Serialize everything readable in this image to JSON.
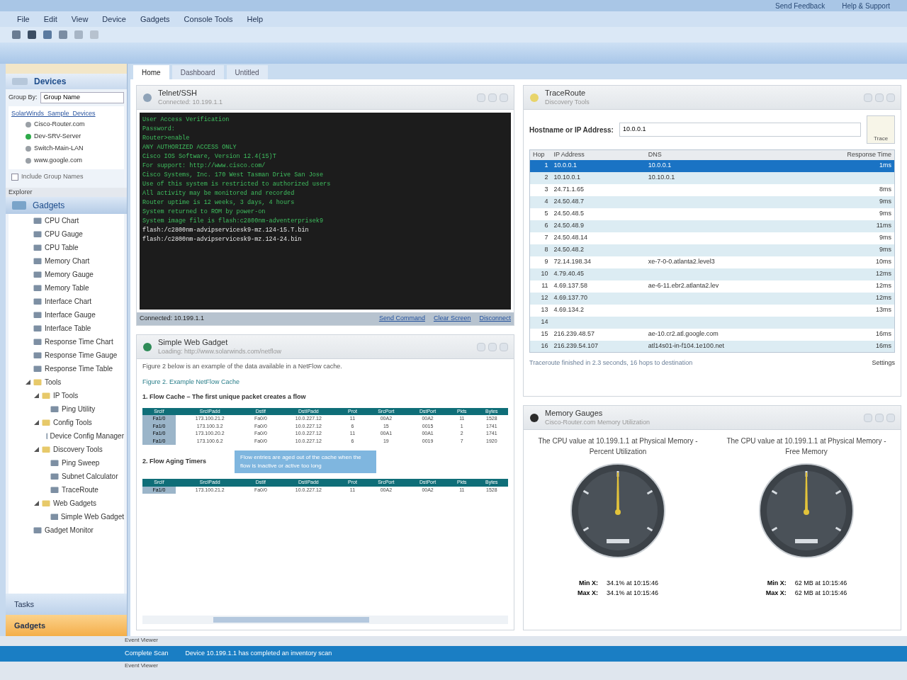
{
  "title_bar": {
    "links": [
      "Send Feedback",
      "Help & Support"
    ]
  },
  "menu": [
    "File",
    "Edit",
    "View",
    "Device",
    "Gadgets",
    "Console Tools",
    "Help"
  ],
  "tabs": [
    {
      "label": "Home",
      "selected": true
    },
    {
      "label": "Dashboard",
      "selected": false
    },
    {
      "label": "Untitled",
      "selected": false
    }
  ],
  "devices": {
    "title": "Devices",
    "group_by_label": "Group By:",
    "group_by_value": "Group Name",
    "root": "SolarWinds_Sample_Devices",
    "items": [
      {
        "label": "Cisco-Router.com",
        "color": "#9aa0a6"
      },
      {
        "label": "Dev-SRV-Server",
        "color": "#2eaa4a"
      },
      {
        "label": "Switch-Main-LAN",
        "color": "#9aa0a6"
      },
      {
        "label": "www.google.com",
        "color": "#9aa0a6"
      }
    ],
    "include_groups": {
      "label": "Include Group Names",
      "checked": false
    }
  },
  "explorer": {
    "title": "Explorer",
    "header": "Gadgets",
    "tree": [
      {
        "label": "CPU Chart"
      },
      {
        "label": "CPU Gauge"
      },
      {
        "label": "CPU Table"
      },
      {
        "label": "Memory Chart"
      },
      {
        "label": "Memory Gauge"
      },
      {
        "label": "Memory Table"
      },
      {
        "label": "Interface Chart"
      },
      {
        "label": "Interface Gauge"
      },
      {
        "label": "Interface Table"
      },
      {
        "label": "Response Time Chart"
      },
      {
        "label": "Response Time Gauge"
      },
      {
        "label": "Response Time Table"
      },
      {
        "label": "Tools",
        "expanded": true,
        "children": [
          {
            "label": "IP Tools",
            "expanded": true,
            "children": [
              {
                "label": "Ping Utility"
              }
            ]
          },
          {
            "label": "Config Tools",
            "expanded": true,
            "children": [
              {
                "label": "Device Config Manager"
              }
            ]
          },
          {
            "label": "Discovery Tools",
            "expanded": true,
            "children": [
              {
                "label": "Ping Sweep"
              },
              {
                "label": "Subnet Calculator"
              },
              {
                "label": "TraceRoute"
              }
            ]
          },
          {
            "label": "Web Gadgets",
            "expanded": true,
            "children": [
              {
                "label": "Simple Web Gadget"
              }
            ]
          }
        ]
      },
      {
        "label": "Gadget Monitor"
      }
    ]
  },
  "nav": [
    {
      "label": "Tasks",
      "selected": false
    },
    {
      "label": "Gadgets",
      "selected": true
    }
  ],
  "terminal": {
    "title": "Telnet/SSH",
    "subtitle": "Connected: 10.199.1.1",
    "lines": [
      "User Access Verification",
      "Password:",
      "Router>enable",
      "ANY AUTHORIZED ACCESS ONLY",
      "Cisco IOS Software, Version 12.4(15)T",
      "For support: http://www.cisco.com/",
      "Cisco Systems, Inc. 170 West Tasman Drive San Jose",
      "Use of this system is restricted to authorized users",
      "All activity may be monitored and recorded",
      "Router uptime is 12 weeks, 3 days, 4 hours",
      "System returned to ROM by power-on",
      "System image file is flash:c2800nm-adventerprisek9",
      "flash:/c2800nm-advipservicesk9-mz.124-15.T.bin",
      "flash:/c2800nm-advipservicesk9-mz.124-24.bin"
    ],
    "status": [
      "Connected: 10.199.1.1",
      "Send Command",
      "Clear Screen",
      "Disconnect"
    ]
  },
  "web": {
    "title": "Simple Web Gadget",
    "subtitle": "Loading: http://www.solarwinds.com/netflow",
    "paragraph": "Figure 2 below is an example of the data available in a NetFlow cache.",
    "caption": "Figure 2. Example NetFlow Cache",
    "heading1": "1. Flow Cache – The first unique packet creates a flow",
    "heading2": "2. Flow Aging Timers",
    "tooltip": "Flow entries are aged out of the cache when the flow is inactive or active too long",
    "columns": [
      "SrcIf",
      "SrcIPadd",
      "DstIf",
      "DstIPadd",
      "Prot",
      "SrcPort",
      "DstPort",
      "Pkts",
      "Bytes"
    ],
    "rows": [
      [
        "Fa1/0",
        "173.100.21.2",
        "Fa0/0",
        "10.0.227.12",
        "11",
        "00A2",
        "00A2",
        "11",
        "1528"
      ],
      [
        "Fa1/0",
        "173.100.3.2",
        "Fa0/0",
        "10.0.227.12",
        "6",
        "15",
        "0015",
        "1",
        "1741"
      ],
      [
        "Fa1/0",
        "173.100.20.2",
        "Fa0/0",
        "10.0.227.12",
        "11",
        "00A1",
        "00A1",
        "2",
        "1741"
      ],
      [
        "Fa1/0",
        "173.100.6.2",
        "Fa0/0",
        "10.0.227.12",
        "6",
        "19",
        "0019",
        "7",
        "1920"
      ]
    ],
    "columns2": [
      "SrcIf",
      "SrcIPadd",
      "DstIf",
      "DstIPadd",
      "Prot",
      "SrcPort",
      "DstPort",
      "Pkts",
      "Bytes"
    ],
    "rows2": [
      [
        "Fa1/0",
        "173.100.21.2",
        "Fa0/0",
        "10.0.227.12",
        "11",
        "00A2",
        "00A2",
        "11",
        "1528"
      ]
    ]
  },
  "traceroute": {
    "title": "TraceRoute",
    "subtitle": "Discovery Tools",
    "host_label": "Hostname or IP Address:",
    "host_value": "10.0.0.1",
    "go": "Trace",
    "columns": [
      "Hop",
      "IP Address",
      "DNS",
      "Response Time"
    ],
    "rows": [
      {
        "hop": "1",
        "ip": "10.0.0.1",
        "dns": "10.0.0.1",
        "time": "1ms",
        "selected": true
      },
      {
        "hop": "2",
        "ip": "10.10.0.1",
        "dns": "10.10.0.1",
        "time": "",
        "selected": false
      },
      {
        "hop": "3",
        "ip": "24.71.1.65",
        "dns": "",
        "time": "8ms",
        "selected": false
      },
      {
        "hop": "4",
        "ip": "24.50.48.7",
        "dns": "",
        "time": "9ms",
        "selected": false
      },
      {
        "hop": "5",
        "ip": "24.50.48.5",
        "dns": "",
        "time": "9ms",
        "selected": false
      },
      {
        "hop": "6",
        "ip": "24.50.48.9",
        "dns": "",
        "time": "11ms",
        "selected": false
      },
      {
        "hop": "7",
        "ip": "24.50.48.14",
        "dns": "",
        "time": "9ms",
        "selected": false
      },
      {
        "hop": "8",
        "ip": "24.50.48.2",
        "dns": "",
        "time": "9ms",
        "selected": false
      },
      {
        "hop": "9",
        "ip": "72.14.198.34",
        "dns": "xe-7-0-0.atlanta2.level3",
        "time": "10ms",
        "selected": false
      },
      {
        "hop": "10",
        "ip": "4.79.40.45",
        "dns": "",
        "time": "12ms",
        "selected": false
      },
      {
        "hop": "11",
        "ip": "4.69.137.58",
        "dns": "ae-6-11.ebr2.atlanta2.lev",
        "time": "12ms",
        "selected": false
      },
      {
        "hop": "12",
        "ip": "4.69.137.70",
        "dns": "",
        "time": "12ms",
        "selected": false
      },
      {
        "hop": "13",
        "ip": "4.69.134.2",
        "dns": "",
        "time": "13ms",
        "selected": false
      },
      {
        "hop": "14",
        "ip": "",
        "dns": "",
        "time": "",
        "selected": false
      },
      {
        "hop": "15",
        "ip": "216.239.48.57",
        "dns": "ae-10.cr2.atl.google.com",
        "time": "16ms",
        "selected": false
      },
      {
        "hop": "16",
        "ip": "216.239.54.107",
        "dns": "atl14s01-in-f104.1e100.net",
        "time": "16ms",
        "selected": false
      }
    ],
    "footer": "Traceroute finished in 2.3 seconds, 16 hops to destination",
    "export": "Settings"
  },
  "gauges": {
    "title": "Memory Gauges",
    "subtitle": "Cisco-Router.com Memory Utilization",
    "items": [
      {
        "caption": "The CPU value at 10.199.1.1 at Physical Memory - Percent Utilization",
        "min_label": "Min X:",
        "min_value": "34.1% at 10:15:46",
        "max_label": "Max X:",
        "max_value": "34.1% at 10:15:46"
      },
      {
        "caption": "The CPU value at 10.199.1.1 at Physical Memory - Free Memory",
        "min_label": "Min X:",
        "min_value": "62 MB at 10:15:46",
        "max_label": "Max X:",
        "max_value": "62 MB at 10:15:46"
      }
    ]
  },
  "event_viewer": {
    "title": "Event Viewer",
    "row": "Complete Scan",
    "message": "Device 10.199.1.1 has completed an inventory scan",
    "subtitle": "Event Viewer"
  }
}
